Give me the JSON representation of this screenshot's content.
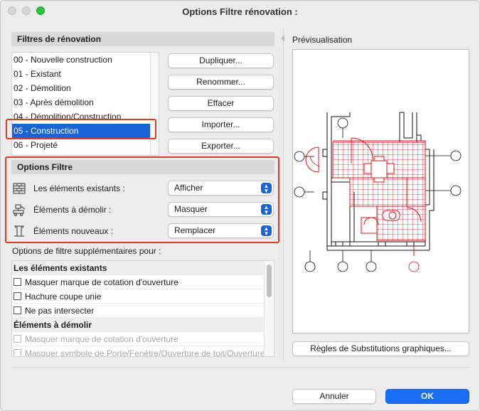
{
  "window": {
    "title": "Options Filtre rénovation :"
  },
  "filters": {
    "header": "Filtres de rénovation",
    "items": [
      {
        "label": "00 - Nouvelle construction",
        "selected": false
      },
      {
        "label": "01 - Existant",
        "selected": false
      },
      {
        "label": "02 - Démolition",
        "selected": false
      },
      {
        "label": "03 - Après démolition",
        "selected": false
      },
      {
        "label": "04 - Démolition/Construction",
        "selected": false
      },
      {
        "label": "05 - Construction",
        "selected": true
      },
      {
        "label": "06 - Projeté",
        "selected": false
      }
    ],
    "buttons": {
      "duplicate": "Dupliquer...",
      "rename": "Renommer...",
      "delete": "Effacer",
      "import": "Importer...",
      "export": "Exporter..."
    }
  },
  "options": {
    "header": "Options Filtre",
    "rows": [
      {
        "label": "Les éléments existants :",
        "icon": "existing-elements-icon",
        "value": "Afficher"
      },
      {
        "label": "Éléments à démolir :",
        "icon": "demolish-elements-icon",
        "value": "Masquer"
      },
      {
        "label": "Éléments nouveaux :",
        "icon": "new-elements-icon",
        "value": "Remplacer"
      }
    ]
  },
  "extra": {
    "label": "Options de filtre supplémentaires pour :",
    "rows": [
      {
        "type": "group",
        "label": "Les éléments existants"
      },
      {
        "type": "check",
        "label": "Masquer marque de cotation d'ouverture",
        "checked": false,
        "disabled": false
      },
      {
        "type": "check",
        "label": "Hachure coupe unie",
        "checked": false,
        "disabled": false
      },
      {
        "type": "check",
        "label": "Ne pas intersecter",
        "checked": false,
        "disabled": false
      },
      {
        "type": "group",
        "label": "Éléments à démolir"
      },
      {
        "type": "check",
        "label": "Masquer marque de cotation d'ouverture",
        "checked": false,
        "disabled": true
      },
      {
        "type": "check",
        "label": "Masquer symbole de Porte/Fenêtre/Ouverture de toit/Ouverture",
        "checked": false,
        "disabled": true
      }
    ]
  },
  "preview": {
    "label": "Prévisualisation"
  },
  "footer": {
    "rules_button": "Règles de Substitutions graphiques...",
    "cancel": "Annuler",
    "ok": "OK"
  },
  "colors": {
    "accent": "#1a64d6",
    "highlight_frame": "#e23a2a",
    "plan_red": "#e0141b"
  }
}
